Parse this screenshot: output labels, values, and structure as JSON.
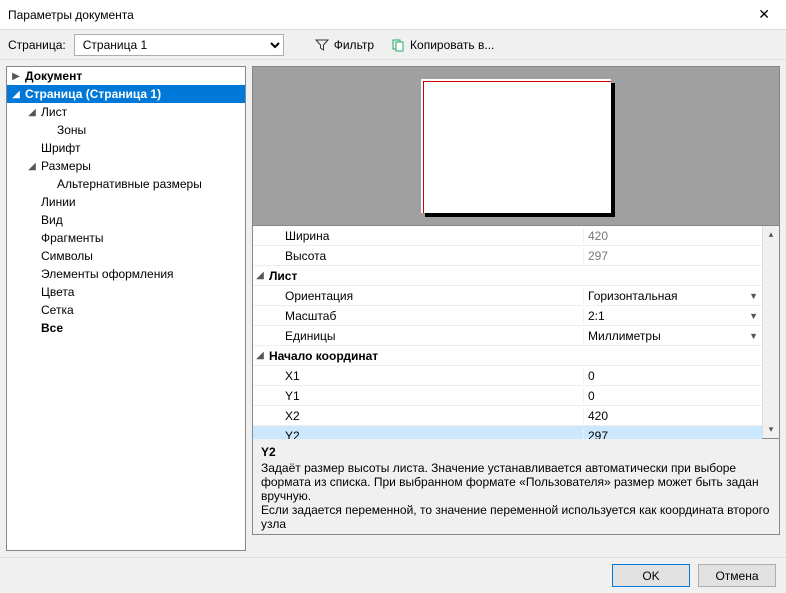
{
  "window": {
    "title": "Параметры документа"
  },
  "toolbar": {
    "page_label": "Страница:",
    "page_value": "Страница 1",
    "filter": "Фильтр",
    "copy_to": "Копировать в..."
  },
  "tree": {
    "document": "Документ",
    "page": "Страница (Страница 1)",
    "sheet": "Лист",
    "zones": "Зоны",
    "font": "Шрифт",
    "sizes": "Размеры",
    "alt_sizes": "Альтернативные размеры",
    "lines": "Линии",
    "view": "Вид",
    "fragments": "Фрагменты",
    "symbols": "Символы",
    "design_elements": "Элементы оформления",
    "colors": "Цвета",
    "grid": "Сетка",
    "all": "Все"
  },
  "props": {
    "width": {
      "label": "Ширина",
      "value": "420"
    },
    "height": {
      "label": "Высота",
      "value": "297"
    },
    "sheet_group": "Лист",
    "orientation": {
      "label": "Ориентация",
      "value": "Горизонтальная"
    },
    "scale": {
      "label": "Масштаб",
      "value": "2:1"
    },
    "units": {
      "label": "Единицы",
      "value": "Миллиметры"
    },
    "origin_group": "Начало координат",
    "x1": {
      "label": "X1",
      "value": "0"
    },
    "y1": {
      "label": "Y1",
      "value": "0"
    },
    "x2": {
      "label": "X2",
      "value": "420"
    },
    "y2": {
      "label": "Y2",
      "value": "297"
    }
  },
  "desc": {
    "title": "Y2",
    "body1": "Задаёт размер высоты листа. Значение устанавливается автоматически при выборе формата из списка. При выбранном формате «Пользователя» размер может быть задан вручную.",
    "body2": "Если задается переменной, то значение переменной используется как координата второго узла"
  },
  "footer": {
    "ok": "OK",
    "cancel": "Отмена"
  }
}
